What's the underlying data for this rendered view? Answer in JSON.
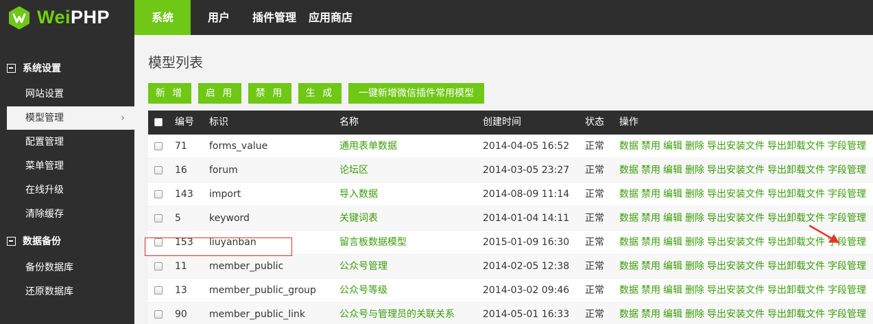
{
  "brand": {
    "wei": "Wei",
    "php": "PHP",
    "accent": "#6fc716",
    "logo_icon": "wechat-leaf-logo"
  },
  "nav": [
    {
      "label": "系统",
      "active": true
    },
    {
      "label": "用户"
    },
    {
      "label": "插件管理"
    },
    {
      "label": "应用商店"
    }
  ],
  "sidebar": {
    "groups": [
      {
        "label": "系统设置",
        "items": [
          "网站设置",
          "模型管理",
          "配置管理",
          "菜单管理",
          "在线升级",
          "清除缓存"
        ]
      },
      {
        "label": "数据备份",
        "items": [
          "备份数据库",
          "还原数据库"
        ]
      }
    ],
    "active_item": "模型管理"
  },
  "main": {
    "title": "模型列表",
    "buttons": [
      "新 增",
      "启 用",
      "禁 用",
      "生 成",
      "一键新增微信插件常用模型"
    ]
  },
  "table": {
    "headers": [
      "编号",
      "标识",
      "名称",
      "创建时间",
      "状态",
      "操作"
    ],
    "ops": [
      "数据",
      "禁用",
      "编辑",
      "删除",
      "导出安装文件",
      "导出卸载文件",
      "字段管理"
    ],
    "rows": [
      {
        "id": "71",
        "mark": "forms_value",
        "name": "通用表单数据",
        "time": "2014-04-05 16:52",
        "status": "正常"
      },
      {
        "id": "16",
        "mark": "forum",
        "name": "论坛区",
        "time": "2014-03-05 23:27",
        "status": "正常"
      },
      {
        "id": "143",
        "mark": "import",
        "name": "导入数据",
        "time": "2014-08-09 11:14",
        "status": "正常"
      },
      {
        "id": "5",
        "mark": "keyword",
        "name": "关键词表",
        "time": "2014-01-04 14:11",
        "status": "正常"
      },
      {
        "id": "153",
        "mark": "liuyanban",
        "name": "留言板数据模型",
        "time": "2015-01-09 16:30",
        "status": "正常"
      },
      {
        "id": "11",
        "mark": "member_public",
        "name": "公众号管理",
        "time": "2014-02-05 12:38",
        "status": "正常"
      },
      {
        "id": "13",
        "mark": "member_public_group",
        "name": "公众号等级",
        "time": "2014-03-02 09:46",
        "status": "正常"
      },
      {
        "id": "90",
        "mark": "member_public_link",
        "name": "公众号与管理员的关联关系",
        "time": "2014-05-01 16:33",
        "status": "正常"
      }
    ]
  }
}
